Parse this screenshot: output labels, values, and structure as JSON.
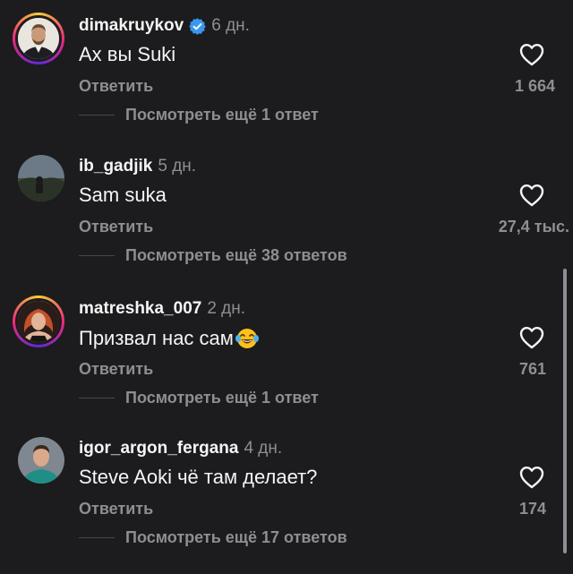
{
  "comments": [
    {
      "username": "dimakruykov",
      "verified": true,
      "time": "6 дн.",
      "text": "Ах вы Suki",
      "emoji": "",
      "reply_label": "Ответить",
      "likes": "1 664",
      "view_replies": "Посмотреть ещё 1 ответ"
    },
    {
      "username": "ib_gadjik",
      "verified": false,
      "time": "5 дн.",
      "text": "Sam suka",
      "emoji": "",
      "reply_label": "Ответить",
      "likes": "27,4 тыс.",
      "view_replies": "Посмотреть ещё 38 ответов"
    },
    {
      "username": "matreshka_007",
      "verified": false,
      "time": "2 дн.",
      "text": "Призвал нас сам",
      "emoji": "face-with-tears-of-joy",
      "reply_label": "Ответить",
      "likes": "761",
      "view_replies": "Посмотреть ещё 1 ответ"
    },
    {
      "username": "igor_argon_fergana",
      "verified": false,
      "time": "4 дн.",
      "text": "Steve Aoki чё там делает?",
      "emoji": "",
      "reply_label": "Ответить",
      "likes": "174",
      "view_replies": "Посмотреть ещё 17 ответов"
    }
  ],
  "colors": {
    "background": "#1c1c1e",
    "text_primary": "#f5f5f5",
    "text_secondary": "#8e8e93",
    "verified_badge": "#3897f0"
  }
}
